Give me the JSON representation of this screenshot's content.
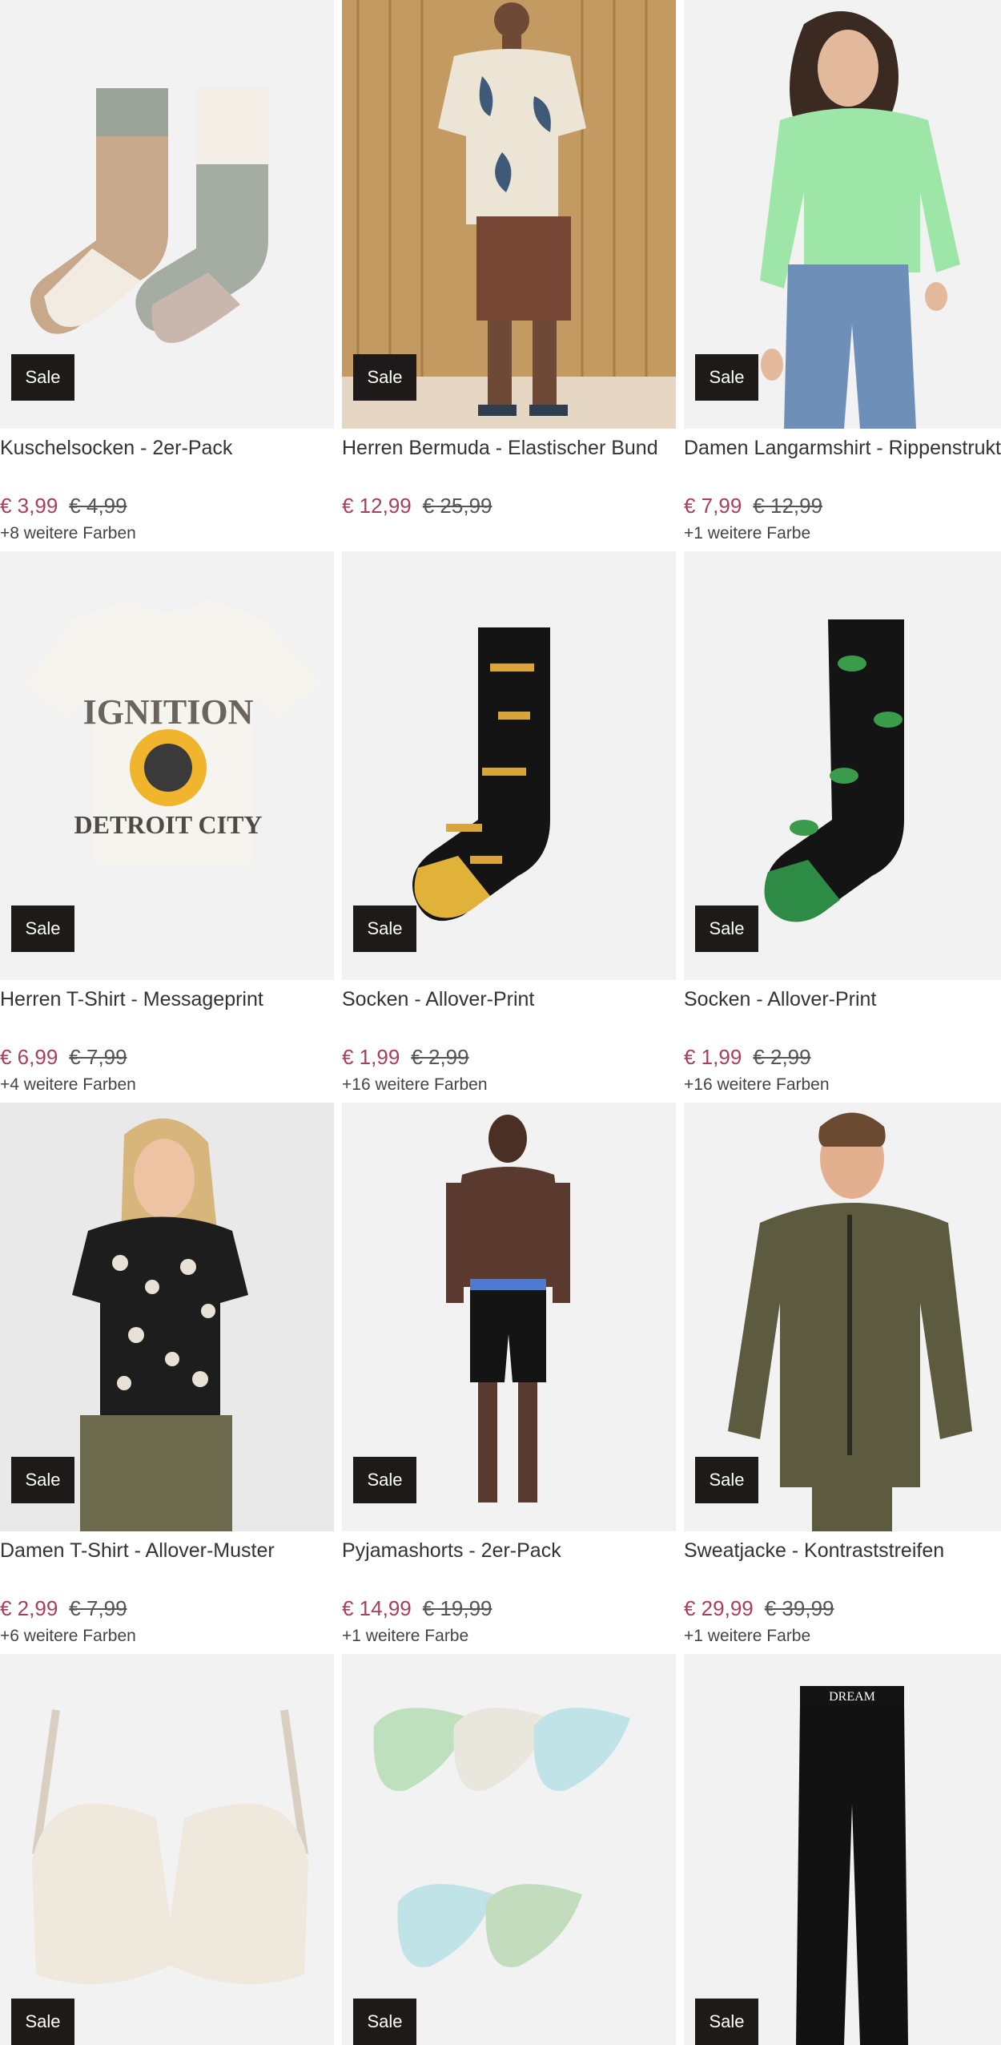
{
  "products": [
    {
      "title": "Kuschelsocken - 2er-Pack",
      "price": "€ 3,99",
      "old_price": "€ 4,99",
      "colors": "+8 weitere Farben",
      "badge": "Sale"
    },
    {
      "title": "Herren Bermuda - Elastischer Bund",
      "price": "€ 12,99",
      "old_price": "€ 25,99",
      "colors": "",
      "badge": "Sale"
    },
    {
      "title": "Damen Langarmshirt - Rippenstruktur",
      "price": "€ 7,99",
      "old_price": "€ 12,99",
      "colors": "+1 weitere Farbe",
      "badge": "Sale"
    },
    {
      "title": "Herren T-Shirt - Messageprint",
      "price": "€ 6,99",
      "old_price": "€ 7,99",
      "colors": "+4 weitere Farben",
      "badge": "Sale"
    },
    {
      "title": "Socken - Allover-Print",
      "price": "€ 1,99",
      "old_price": "€ 2,99",
      "colors": "+16 weitere Farben",
      "badge": "Sale"
    },
    {
      "title": "Socken - Allover-Print",
      "price": "€ 1,99",
      "old_price": "€ 2,99",
      "colors": "+16 weitere Farben",
      "badge": "Sale"
    },
    {
      "title": "Damen T-Shirt - Allover-Muster",
      "price": "€ 2,99",
      "old_price": "€ 7,99",
      "colors": "+6 weitere Farben",
      "badge": "Sale"
    },
    {
      "title": "Pyjamashorts - 2er-Pack",
      "price": "€ 14,99",
      "old_price": "€ 19,99",
      "colors": "+1 weitere Farbe",
      "badge": "Sale"
    },
    {
      "title": "Sweatjacke - Kontraststreifen",
      "price": "€ 29,99",
      "old_price": "€ 39,99",
      "colors": "+1 weitere Farbe",
      "badge": "Sale"
    },
    {
      "badge": "Sale"
    },
    {
      "badge": "Sale"
    },
    {
      "badge": "Sale"
    }
  ],
  "image_text": {
    "tshirt_print_top": "IGNITION",
    "tshirt_print_bottom": "DETROIT CITY",
    "leggings_waistband": "DREAM"
  },
  "colors": {
    "price": "#a8405d",
    "badge_bg": "#1f1a1a"
  }
}
